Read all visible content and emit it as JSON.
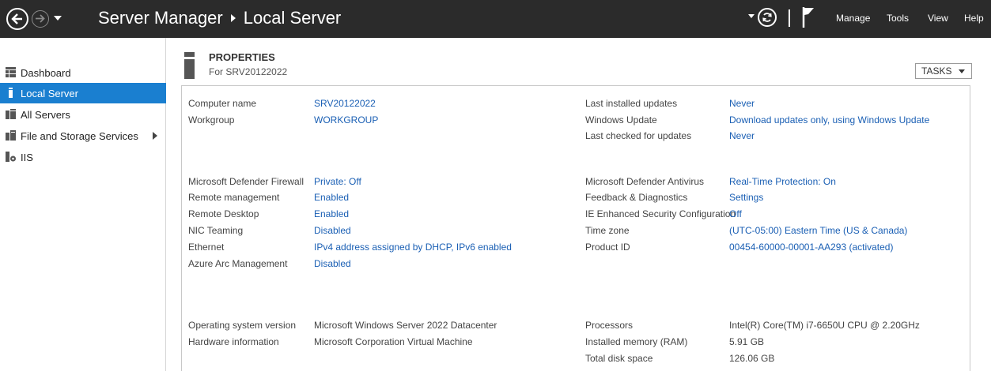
{
  "titlebar": {
    "app_name": "Server Manager",
    "page_name": "Local Server",
    "menu": [
      "Manage",
      "Tools",
      "View",
      "Help"
    ]
  },
  "sidebar": {
    "items": [
      {
        "label": "Dashboard",
        "icon": "dashboard-icon",
        "active": false
      },
      {
        "label": "Local Server",
        "icon": "server-icon",
        "active": true
      },
      {
        "label": "All Servers",
        "icon": "servers-icon",
        "active": false
      },
      {
        "label": "File and Storage Services",
        "icon": "storage-icon",
        "active": false
      },
      {
        "label": "IIS",
        "icon": "iis-icon",
        "active": false
      }
    ]
  },
  "properties": {
    "title": "PROPERTIES",
    "subtitle": "For SRV20122022",
    "tasks_label": "TASKS",
    "left": [
      {
        "label": "Computer name",
        "value": "SRV20122022"
      },
      {
        "label": "Workgroup",
        "value": "WORKGROUP"
      },
      {
        "label": "Microsoft Defender Firewall",
        "value": "Private: Off"
      },
      {
        "label": "Remote management",
        "value": "Enabled"
      },
      {
        "label": "Remote Desktop",
        "value": "Enabled"
      },
      {
        "label": "NIC Teaming",
        "value": "Disabled"
      },
      {
        "label": "Ethernet",
        "value": "IPv4 address assigned by DHCP, IPv6 enabled"
      },
      {
        "label": "Azure Arc Management",
        "value": "Disabled"
      },
      {
        "label": "Operating system version",
        "value": "Microsoft Windows Server 2022 Datacenter"
      },
      {
        "label": "Hardware information",
        "value": "Microsoft Corporation Virtual Machine"
      }
    ],
    "right": [
      {
        "label": "Last installed updates",
        "value": "Never"
      },
      {
        "label": "Windows Update",
        "value": "Download updates only, using Windows Update"
      },
      {
        "label": "Last checked for updates",
        "value": "Never"
      },
      {
        "label": "Microsoft Defender Antivirus",
        "value": "Real-Time Protection: On"
      },
      {
        "label": "Feedback & Diagnostics",
        "value": "Settings"
      },
      {
        "label": "IE Enhanced Security Configuration",
        "value": "Off"
      },
      {
        "label": "Time zone",
        "value": "(UTC-05:00) Eastern Time (US & Canada)"
      },
      {
        "label": "Product ID",
        "value": "00454-60000-00001-AA293 (activated)"
      },
      {
        "label": "Processors",
        "value": "Intel(R) Core(TM) i7-6650U CPU @ 2.20GHz"
      },
      {
        "label": "Installed memory (RAM)",
        "value": "5.91 GB"
      },
      {
        "label": "Total disk space",
        "value": "126.06 GB"
      }
    ]
  },
  "colors": {
    "titlebar_bg": "#2b2b2b",
    "selected_bg": "#1a7fd0",
    "link": "#1a5fb4"
  }
}
